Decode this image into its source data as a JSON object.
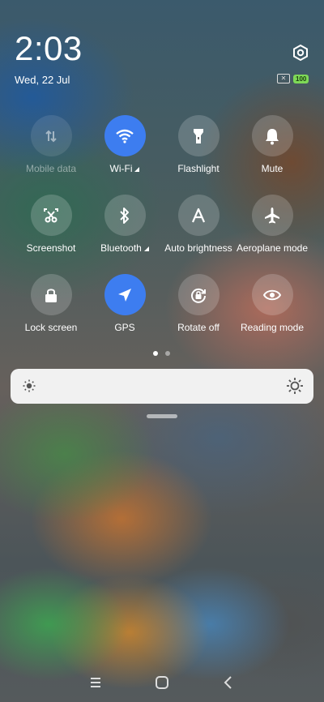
{
  "status": {
    "time": "2:03",
    "date": "Wed, 22 Jul",
    "battery": "100"
  },
  "tiles": [
    {
      "label": "Mobile data",
      "icon": "mobile-data-icon",
      "state": "unavailable"
    },
    {
      "label": "Wi-Fi",
      "icon": "wifi-icon",
      "state": "on"
    },
    {
      "label": "Flashlight",
      "icon": "flashlight-icon",
      "state": "off"
    },
    {
      "label": "Mute",
      "icon": "bell-icon",
      "state": "off"
    },
    {
      "label": "Screenshot",
      "icon": "scissors-icon",
      "state": "off"
    },
    {
      "label": "Bluetooth",
      "icon": "bluetooth-icon",
      "state": "off"
    },
    {
      "label": "Auto brightness",
      "icon": "auto-brightness-icon",
      "state": "off"
    },
    {
      "label": "Aeroplane mode",
      "icon": "airplane-icon",
      "state": "off"
    },
    {
      "label": "Lock screen",
      "icon": "lock-icon",
      "state": "off"
    },
    {
      "label": "GPS",
      "icon": "navigation-arrow-icon",
      "state": "on"
    },
    {
      "label": "Rotate off",
      "icon": "rotate-lock-icon",
      "state": "off"
    },
    {
      "label": "Reading mode",
      "icon": "eye-icon",
      "state": "off"
    }
  ],
  "pager": {
    "pages": 2,
    "current": 1
  },
  "brightness": {
    "level": 0
  },
  "colors": {
    "active_tile": "#3d7df0",
    "battery_fill": "#7ed957"
  }
}
